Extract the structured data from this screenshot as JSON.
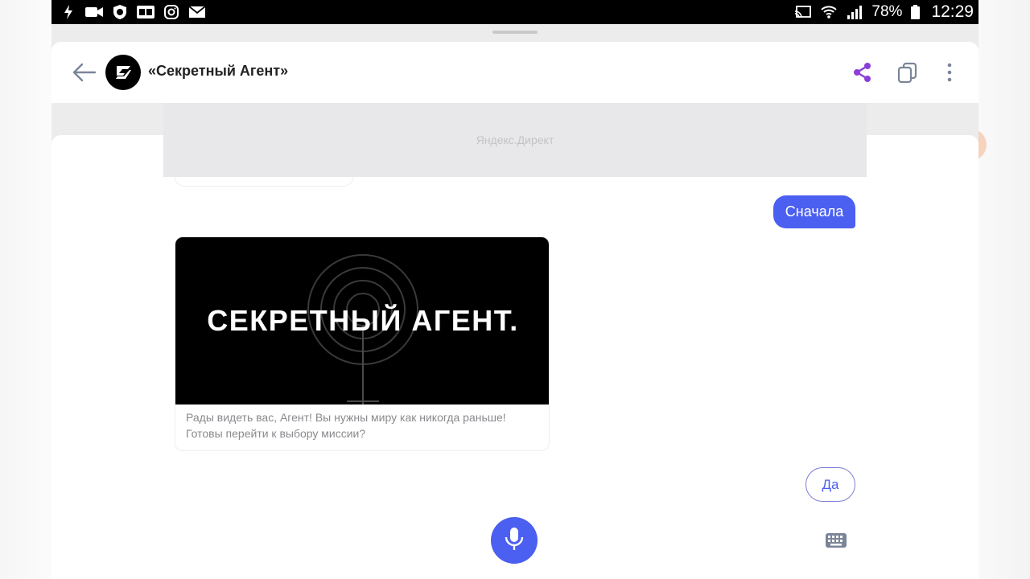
{
  "status_bar": {
    "battery": "78%",
    "time": "12:29",
    "left_icons": [
      "flash-icon",
      "video-icon",
      "shield-icon",
      "gb-icon",
      "instagram-icon",
      "mail-icon"
    ],
    "right_icons": [
      "cast-icon",
      "wifi-icon",
      "signal-icon",
      "battery-icon"
    ]
  },
  "header": {
    "title": "«Секретный Агент»",
    "icons": [
      "back-arrow-icon",
      "share-icon",
      "cards-icon",
      "more-vert-icon"
    ],
    "share_color": "#8b3fd8"
  },
  "ad": {
    "label": "Яндекс.Директ"
  },
  "chat": {
    "user_message": "Сначала",
    "card": {
      "image_title": "СЕКРЕТНЫЙ АГЕНТ.",
      "text_line1": "Рады видеть вас, Агент! Вы нужны миру как никогда раньше!",
      "text_line2": "Готовы перейти к выбору миссии?"
    },
    "suggest_button": "Да"
  },
  "colors": {
    "accent": "#4b5ff0",
    "status_bar": "#000000"
  }
}
